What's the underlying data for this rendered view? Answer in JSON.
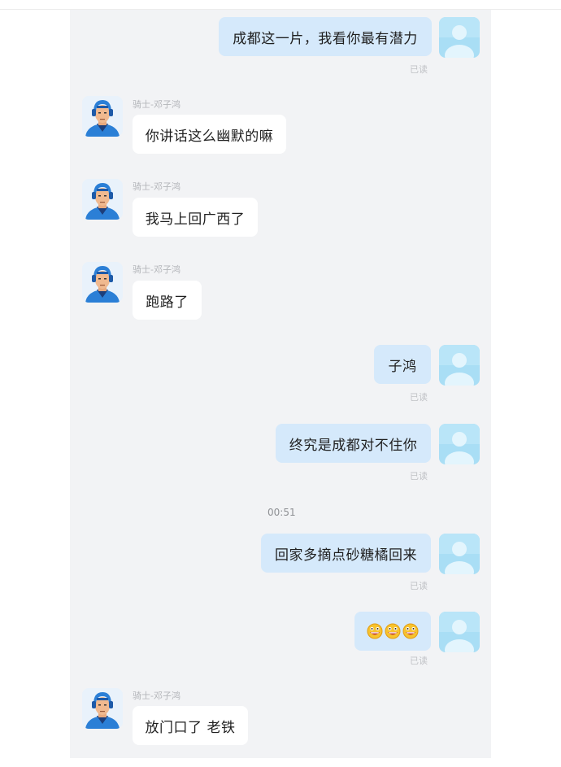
{
  "chat": {
    "messages": [
      {
        "from": "me",
        "text": "成都这一片，我看你最有潜力",
        "status": "已读"
      },
      {
        "from": "other",
        "sender": "骑士-邓子鸿",
        "text": "你讲话这么幽默的嘛"
      },
      {
        "from": "other",
        "sender": "骑士-邓子鸿",
        "text": "我马上回广西了"
      },
      {
        "from": "other",
        "sender": "骑士-邓子鸿",
        "text": "跑路了"
      },
      {
        "from": "me",
        "text": "子鸿",
        "status": "已读"
      },
      {
        "from": "me",
        "text": "终究是成都对不住你",
        "status": "已读"
      },
      {
        "from": "me",
        "text": "回家多摘点砂糖橘回来",
        "status": "已读"
      },
      {
        "from": "me",
        "emoji": [
          "grinning-face-icon",
          "grinning-face-icon",
          "grinning-face-icon"
        ],
        "status": "已读"
      },
      {
        "from": "other",
        "sender": "骑士-邓子鸿",
        "text": "放门口了 老铁"
      }
    ],
    "timestamp": "00:51"
  },
  "colors": {
    "panel_bg": "#f2f3f5",
    "outgoing_bubble": "#d5e9fb",
    "incoming_bubble": "#ffffff",
    "avatar_self": "#a9def5",
    "rider_helmet": "#2b7fd6"
  }
}
